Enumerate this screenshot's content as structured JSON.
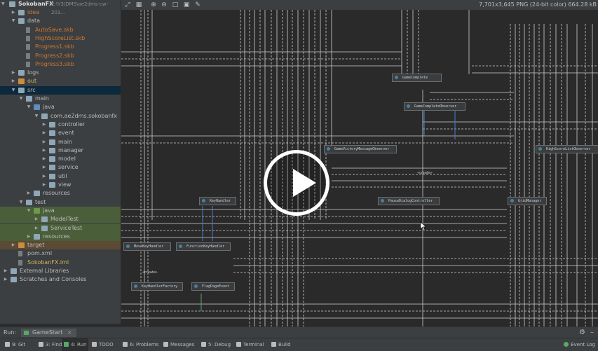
{
  "project": {
    "root_name": "SokobanFX",
    "root_path": "E:\\Y3\\DMS\\ae2dms-cw-201...",
    "items": [
      {
        "label": "idea",
        "depth": 2,
        "type": "folder",
        "expanded": false,
        "color": "#cc7832"
      },
      {
        "label": "data",
        "depth": 2,
        "type": "folder",
        "expanded": true,
        "color": "#bbbbbb"
      },
      {
        "label": "AutoSave.skb",
        "depth": 3,
        "type": "file",
        "color": "#cc7832"
      },
      {
        "label": "HighScoreList.skb",
        "depth": 3,
        "type": "file",
        "color": "#cc7832"
      },
      {
        "label": "Progress1.skb",
        "depth": 3,
        "type": "file",
        "color": "#cc7832"
      },
      {
        "label": "Progress2.skb",
        "depth": 3,
        "type": "file",
        "color": "#cc7832"
      },
      {
        "label": "Progress3.skb",
        "depth": 3,
        "type": "file",
        "color": "#cc7832"
      },
      {
        "label": "logs",
        "depth": 2,
        "type": "folder",
        "expanded": false,
        "color": "#bbbbbb"
      },
      {
        "label": "out",
        "depth": 2,
        "type": "folder-orange",
        "expanded": false,
        "color": "#d0b060"
      },
      {
        "label": "src",
        "depth": 2,
        "type": "folder",
        "expanded": true,
        "color": "#bbbbbb",
        "selected": true
      },
      {
        "label": "main",
        "depth": 3,
        "type": "folder",
        "expanded": true,
        "color": "#bbbbbb"
      },
      {
        "label": "java",
        "depth": 4,
        "type": "folder-blue",
        "expanded": true,
        "color": "#bbbbbb"
      },
      {
        "label": "com.ae2dms.sokobanfx",
        "depth": 5,
        "type": "pkg",
        "expanded": true,
        "color": "#bbbbbb"
      },
      {
        "label": "controller",
        "depth": 6,
        "type": "pkg",
        "expanded": false,
        "color": "#bbbbbb"
      },
      {
        "label": "event",
        "depth": 6,
        "type": "pkg",
        "expanded": false,
        "color": "#bbbbbb"
      },
      {
        "label": "main",
        "depth": 6,
        "type": "pkg",
        "expanded": false,
        "color": "#bbbbbb"
      },
      {
        "label": "manager",
        "depth": 6,
        "type": "pkg",
        "expanded": false,
        "color": "#bbbbbb"
      },
      {
        "label": "model",
        "depth": 6,
        "type": "pkg",
        "expanded": false,
        "color": "#bbbbbb"
      },
      {
        "label": "service",
        "depth": 6,
        "type": "pkg",
        "expanded": false,
        "color": "#bbbbbb"
      },
      {
        "label": "util",
        "depth": 6,
        "type": "pkg",
        "expanded": false,
        "color": "#bbbbbb"
      },
      {
        "label": "view",
        "depth": 6,
        "type": "pkg",
        "expanded": false,
        "color": "#bbbbbb"
      },
      {
        "label": "resources",
        "depth": 4,
        "type": "folder",
        "expanded": false,
        "color": "#bbbbbb"
      },
      {
        "label": "test",
        "depth": 3,
        "type": "folder",
        "expanded": true,
        "color": "#bbbbbb"
      },
      {
        "label": "java",
        "depth": 4,
        "type": "folder-green",
        "expanded": true,
        "color": "#bbbbbb",
        "green": true
      },
      {
        "label": "ModelTest",
        "depth": 5,
        "type": "pkg",
        "expanded": false,
        "color": "#bbbbbb",
        "green": true
      },
      {
        "label": "ServiceTest",
        "depth": 5,
        "type": "pkg",
        "expanded": false,
        "color": "#bbbbbb",
        "green": true
      },
      {
        "label": "resources",
        "depth": 4,
        "type": "folder",
        "expanded": false,
        "color": "#bbbbbb",
        "green": true
      },
      {
        "label": "target",
        "depth": 2,
        "type": "folder-orange",
        "expanded": false,
        "color": "#bbbbbb",
        "orange": true
      },
      {
        "label": "pom.xml",
        "depth": 2,
        "type": "mfile",
        "color": "#bbbbbb"
      },
      {
        "label": "SokobanFX.iml",
        "depth": 2,
        "type": "file",
        "color": "#d0b060"
      },
      {
        "label": "External Libraries",
        "depth": 1,
        "type": "lib",
        "expanded": false,
        "color": "#bbbbbb"
      },
      {
        "label": "Scratches and Consoles",
        "depth": 1,
        "type": "scratch",
        "expanded": false,
        "color": "#bbbbbb"
      }
    ]
  },
  "viewer": {
    "image_info": "7,701x3,645 PNG (24-bit color) 664.28 kB",
    "toolbar_icons": [
      "fit-icon",
      "grid-icon",
      "zoom-in-icon",
      "zoom-out-icon",
      "actual-size-icon",
      "fit-window-icon",
      "color-picker-icon"
    ]
  },
  "diagram": {
    "nodes": [
      {
        "name": "GameComplete"
      },
      {
        "name": "GameCompleteObserver"
      },
      {
        "name": "GameVictoryMessageObserver"
      },
      {
        "name": "HighScoreListObserver"
      },
      {
        "name": "KeyHandler"
      },
      {
        "name": "PauseDialogController"
      },
      {
        "name": "GridManager"
      },
      {
        "name": "MoveKeyHandler"
      },
      {
        "name": "FunctionKeyHandler"
      },
      {
        "name": "KeyHandlerFactory"
      },
      {
        "name": "FlagPageEvent"
      }
    ],
    "stereotype": "«create»"
  },
  "run": {
    "label": "Run:",
    "tab": "GameStart"
  },
  "bottom_tabs": [
    {
      "key": "9",
      "label": "Git",
      "icon": "git-icon",
      "color": "#bbbbbb"
    },
    {
      "key": "3",
      "label": "Find",
      "icon": "find-icon",
      "color": "#bbbbbb"
    },
    {
      "key": "4",
      "label": "Run",
      "icon": "run-icon",
      "color": "#59a869",
      "active": true
    },
    {
      "key": "",
      "label": "TODO",
      "icon": "todo-icon",
      "color": "#bbbbbb"
    },
    {
      "key": "6",
      "label": "Problems",
      "icon": "problems-icon",
      "color": "#bbbbbb"
    },
    {
      "key": "",
      "label": "Messages",
      "icon": "messages-icon",
      "color": "#bbbbbb"
    },
    {
      "key": "5",
      "label": "Debug",
      "icon": "debug-icon",
      "color": "#bbbbbb"
    },
    {
      "key": "",
      "label": "Terminal",
      "icon": "terminal-icon",
      "color": "#bbbbbb"
    },
    {
      "key": "",
      "label": "Build",
      "icon": "build-icon",
      "color": "#bbbbbb"
    }
  ],
  "event_log": "Event Log"
}
